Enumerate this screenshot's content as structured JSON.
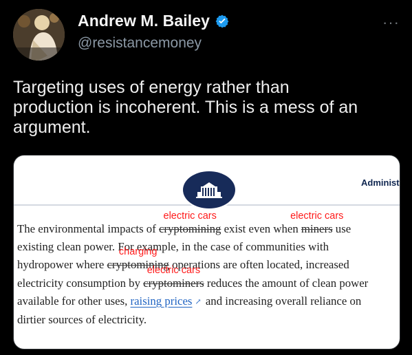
{
  "author": {
    "display_name": "Andrew M. Bailey",
    "handle": "@resistancemoney",
    "verified": true,
    "verified_icon": "verified-badge-icon"
  },
  "more_label": "···",
  "tweet_text": "Targeting uses of energy rather than\nproduction is incoherent. This is a mess of an\nargument.",
  "media": {
    "header_label": "Administr",
    "article_lines": [
      {
        "before": "The environmental impacts of ",
        "crossed": "cryptomining",
        "annotation": "electric cars",
        "middle": " exist even when ",
        "crossed2": "miners",
        "annotation2": "electric cars",
        "after": " use"
      },
      {
        "text": "existing clean power. For example, in the case of communities with"
      },
      {
        "before": "hydropower where ",
        "crossed": "cryptomining",
        "annotation": "charging",
        "after": " operations are often located, increased"
      },
      {
        "before": "electricity consumption by ",
        "crossed": "cryptominers",
        "annotation": "electric cars",
        "after": " reduces the amount of clean power"
      },
      {
        "before": "available for other uses, ",
        "link": "raising prices",
        "after": " and increasing overall reliance on"
      },
      {
        "text": "dirtier sources of electricity."
      }
    ]
  },
  "colors": {
    "background": "#000000",
    "verified_blue": "#1d9bf0",
    "annotation_red": "#ff1a1a",
    "link_blue": "#1f63c2"
  }
}
